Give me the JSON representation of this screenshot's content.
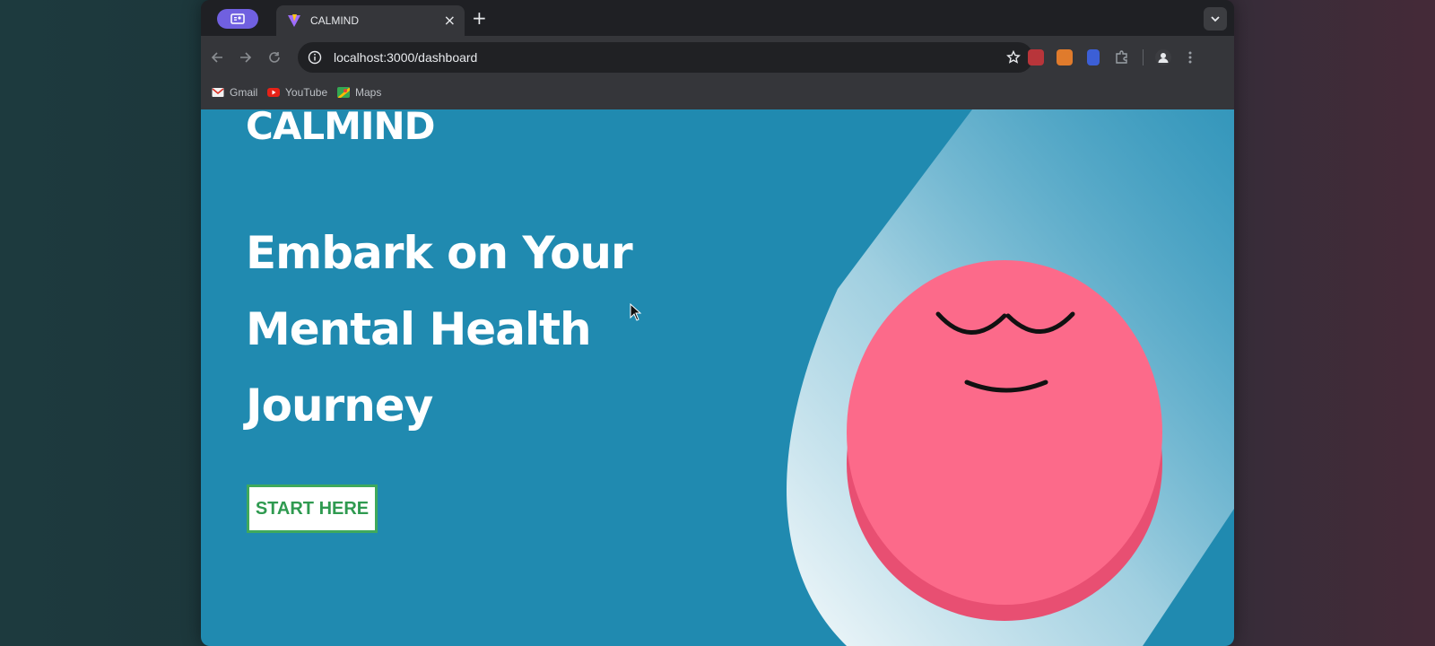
{
  "browser": {
    "tab_title": "CALMIND",
    "new_tab_symbol": "+",
    "close_symbol": "×",
    "url": "localhost:3000/dashboard",
    "bookmarks": [
      {
        "label": "Gmail",
        "icon": "gmail-icon",
        "color": "#d93025"
      },
      {
        "label": "YouTube",
        "icon": "youtube-icon",
        "color": "#e62117"
      },
      {
        "label": "Maps",
        "icon": "maps-icon",
        "color": "#34a853"
      }
    ]
  },
  "page": {
    "brand": "CALMIND",
    "headline": "Embark on Your Mental Health Journey",
    "cta_label": "START HERE"
  },
  "colors": {
    "page_background": "#208ab0",
    "mascot_pink": "#fc6a8a",
    "cta_green": "#2f9a50"
  }
}
